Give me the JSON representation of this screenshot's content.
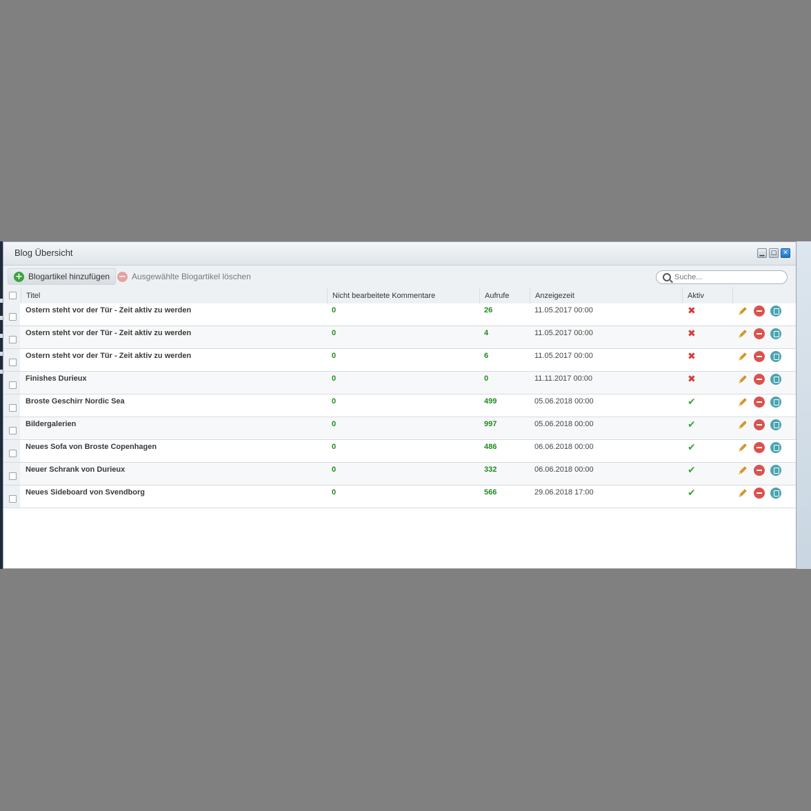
{
  "window": {
    "title": "Blog Übersicht",
    "buttons": {
      "minimize_icon": "minimize-icon",
      "maximize_icon": "maximize-icon",
      "close_icon": "close-icon"
    }
  },
  "toolbar": {
    "add_label": "Blogartikel hinzufügen",
    "delete_label": "Ausgewählte Blogartikel löschen",
    "search_placeholder": "Suche..."
  },
  "columns": {
    "title": "Titel",
    "comments": "Nicht bearbeitete Kommentare",
    "views": "Aufrufe",
    "date": "Anzeigezeit",
    "active": "Aktiv"
  },
  "rows": [
    {
      "title": "Ostern steht vor der Tür - Zeit aktiv zu werden",
      "comments": "0",
      "views": "26",
      "date": "11.05.2017 00:00",
      "active": false
    },
    {
      "title": "Ostern steht vor der Tür - Zeit aktiv zu werden",
      "comments": "0",
      "views": "4",
      "date": "11.05.2017 00:00",
      "active": false
    },
    {
      "title": "Ostern steht vor der Tür - Zeit aktiv zu werden",
      "comments": "0",
      "views": "6",
      "date": "11.05.2017 00:00",
      "active": false
    },
    {
      "title": "Finishes Durieux",
      "comments": "0",
      "views": "0",
      "date": "11.11.2017 00:00",
      "active": false
    },
    {
      "title": "Broste Geschirr Nordic Sea",
      "comments": "0",
      "views": "499",
      "date": "05.06.2018 00:00",
      "active": true
    },
    {
      "title": "Bildergalerien",
      "comments": "0",
      "views": "997",
      "date": "05.06.2018 00:00",
      "active": true
    },
    {
      "title": "Neues Sofa von Broste Copenhagen",
      "comments": "0",
      "views": "486",
      "date": "06.06.2018 00:00",
      "active": true
    },
    {
      "title": "Neuer Schrank von Durieux",
      "comments": "0",
      "views": "332",
      "date": "06.06.2018 00:00",
      "active": true
    },
    {
      "title": "Neues Sideboard von Svendborg",
      "comments": "0",
      "views": "566",
      "date": "29.06.2018 17:00",
      "active": true
    }
  ],
  "colors": {
    "accent_green": "#1e8a1e",
    "inactive_red": "#d43b3b",
    "delete_red": "#d9534f",
    "duplicate_teal": "#4ba4b0",
    "edit_orange": "#e8a020"
  },
  "icons": {
    "active_yes": "✔",
    "active_no": "✖",
    "row_actions": [
      "pencil-icon",
      "delete-icon",
      "duplicate-icon"
    ]
  }
}
